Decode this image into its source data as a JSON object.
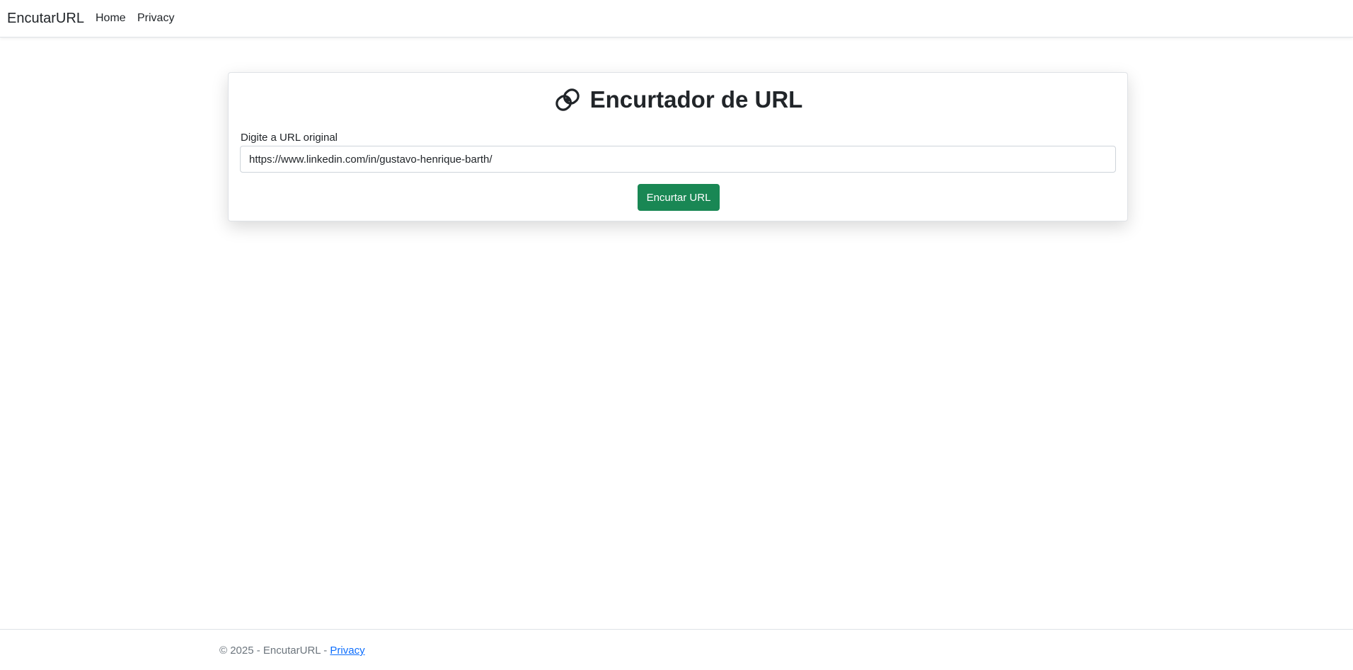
{
  "navbar": {
    "brand": "EncutarURL",
    "links": [
      {
        "label": "Home"
      },
      {
        "label": "Privacy"
      }
    ]
  },
  "card": {
    "title": "Encurtador de URL",
    "icon": "link-icon",
    "url_label": "Digite a URL original",
    "url_value": "https://www.linkedin.com/in/gustavo-henrique-barth/",
    "submit_label": "Encurtar URL"
  },
  "footer": {
    "copyright": "© 2025 - EncutarURL - ",
    "privacy_link": "Privacy"
  },
  "colors": {
    "primary_button": "#198754",
    "link": "#0d6efd",
    "muted_text": "#6c757d"
  }
}
